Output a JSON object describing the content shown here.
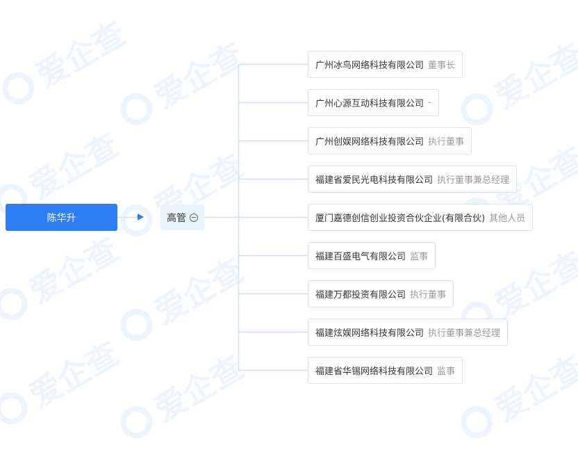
{
  "watermark": {
    "text": "爱企查"
  },
  "root": {
    "name": "陈华升"
  },
  "category": {
    "label": "高管",
    "toggle_icon": "collapse-circle-icon"
  },
  "positions": [
    {
      "company": "广州冰鸟网络科技有限公司",
      "role": "董事长"
    },
    {
      "company": "广州心源互动科技有限公司",
      "role": "-"
    },
    {
      "company": "广州创娱网络科技有限公司",
      "role": "执行董事"
    },
    {
      "company": "福建省爱民光电科技有限公司",
      "role": "执行董事兼总经理"
    },
    {
      "company": "厦门嘉德创信创业投资合伙企业(有限合伙)",
      "role": "其他人员"
    },
    {
      "company": "福建百盛电气有限公司",
      "role": "监事"
    },
    {
      "company": "福建万都投资有限公司",
      "role": "执行董事"
    },
    {
      "company": "福建炫娱网络科技有限公司",
      "role": "执行董事兼总经理"
    },
    {
      "company": "福建省华锡网络科技有限公司",
      "role": "监事"
    }
  ],
  "colors": {
    "root_fill": "#2f7ef5",
    "category_fill": "#eaf3fd",
    "connector": "#cfe0f5",
    "role_text": "#999999"
  }
}
